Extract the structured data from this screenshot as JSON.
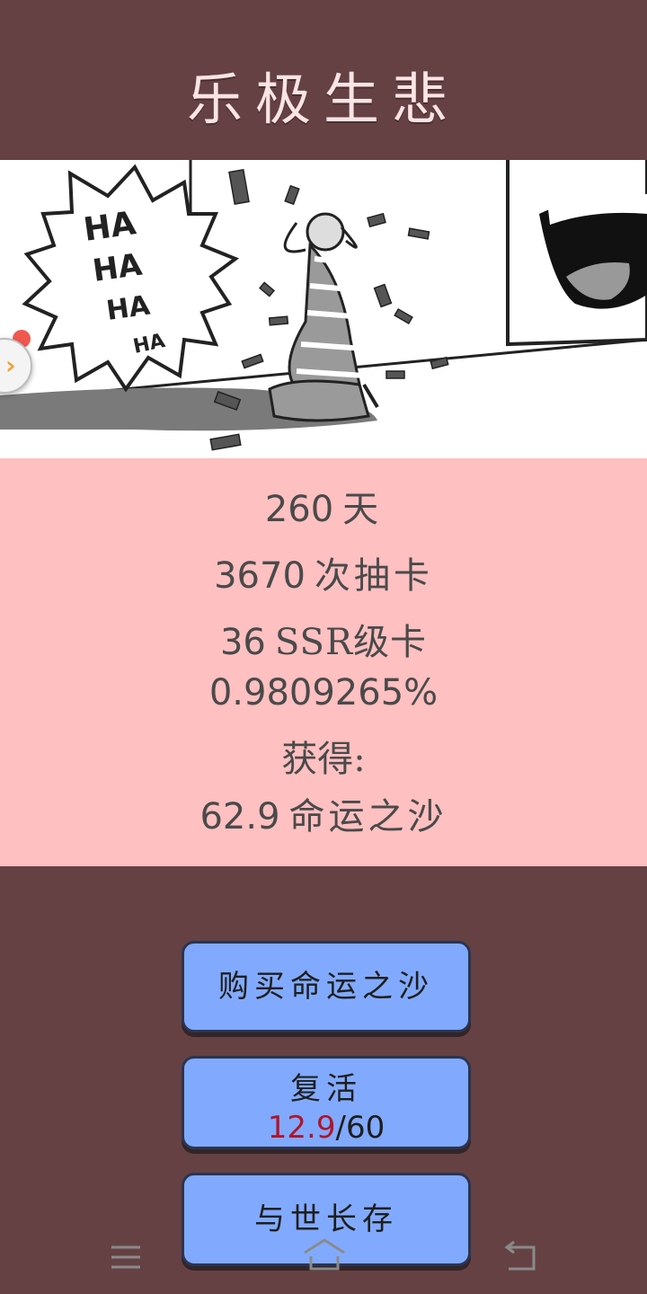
{
  "header": {
    "title": "乐极生悲"
  },
  "comic": {
    "speech": [
      "HA",
      "HA",
      "HA",
      "HA"
    ]
  },
  "stats": {
    "days": {
      "value": "260",
      "unit": "天"
    },
    "draws": {
      "value": "3670",
      "unit": "次抽卡"
    },
    "ssr": {
      "value": "36",
      "unit": "SSR级卡"
    },
    "rate": "0.9809265%",
    "obtained_label": "获得:",
    "sand": {
      "value": "62.9",
      "unit": "命运之沙"
    }
  },
  "buttons": {
    "buy": "购买命运之沙",
    "revive": {
      "label": "复活",
      "current": "12.9",
      "total": "/60"
    },
    "immortal": "与世长存"
  },
  "nav": {
    "menu_icon": "menu-icon",
    "home_icon": "home-icon",
    "back_icon": "back-icon"
  },
  "colors": {
    "accent_red": "#b0152a",
    "button": "#81aafe",
    "panel": "#fec0c1",
    "background": "#654144"
  }
}
